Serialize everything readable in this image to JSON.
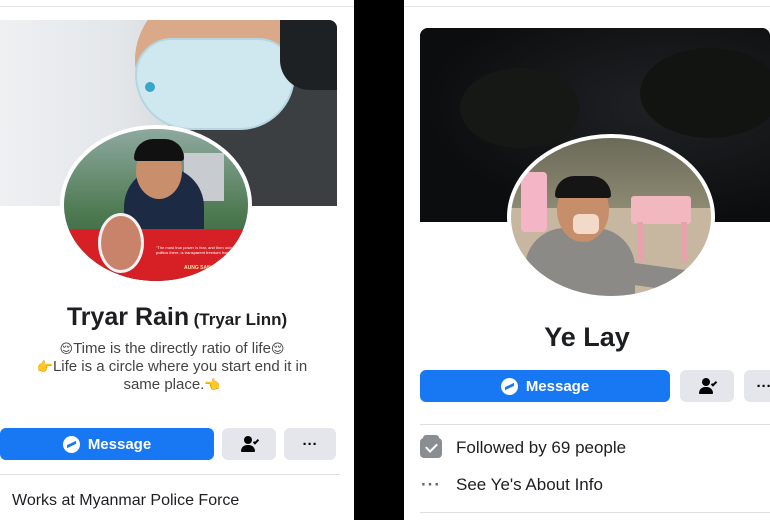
{
  "left_profile": {
    "name": "Tryar Rain",
    "alt_name": "(Tryar Linn)",
    "bio_line1": "Time is the directly ratio of life",
    "bio_line2": "Life is a circle where you start end it in",
    "bio_line3": "same place.",
    "message_label": "Message",
    "more_label": "···",
    "works_at": "Works at Myanmar Police Force",
    "avatar_banner_quote": "\"The most true power is fear, and then only in politics there, is transparent freedom from fear.\"",
    "avatar_banner_name": "AUNG SAN SU KYI"
  },
  "right_profile": {
    "name": "Ye Lay",
    "message_label": "Message",
    "more_label": "···",
    "followed_by": "Followed by 69 people",
    "about_info": "See Ye's About Info"
  },
  "colors": {
    "accent_blue": "#1877f2",
    "grey_button": "#e4e6eb",
    "text_dark": "#1c1e21"
  }
}
